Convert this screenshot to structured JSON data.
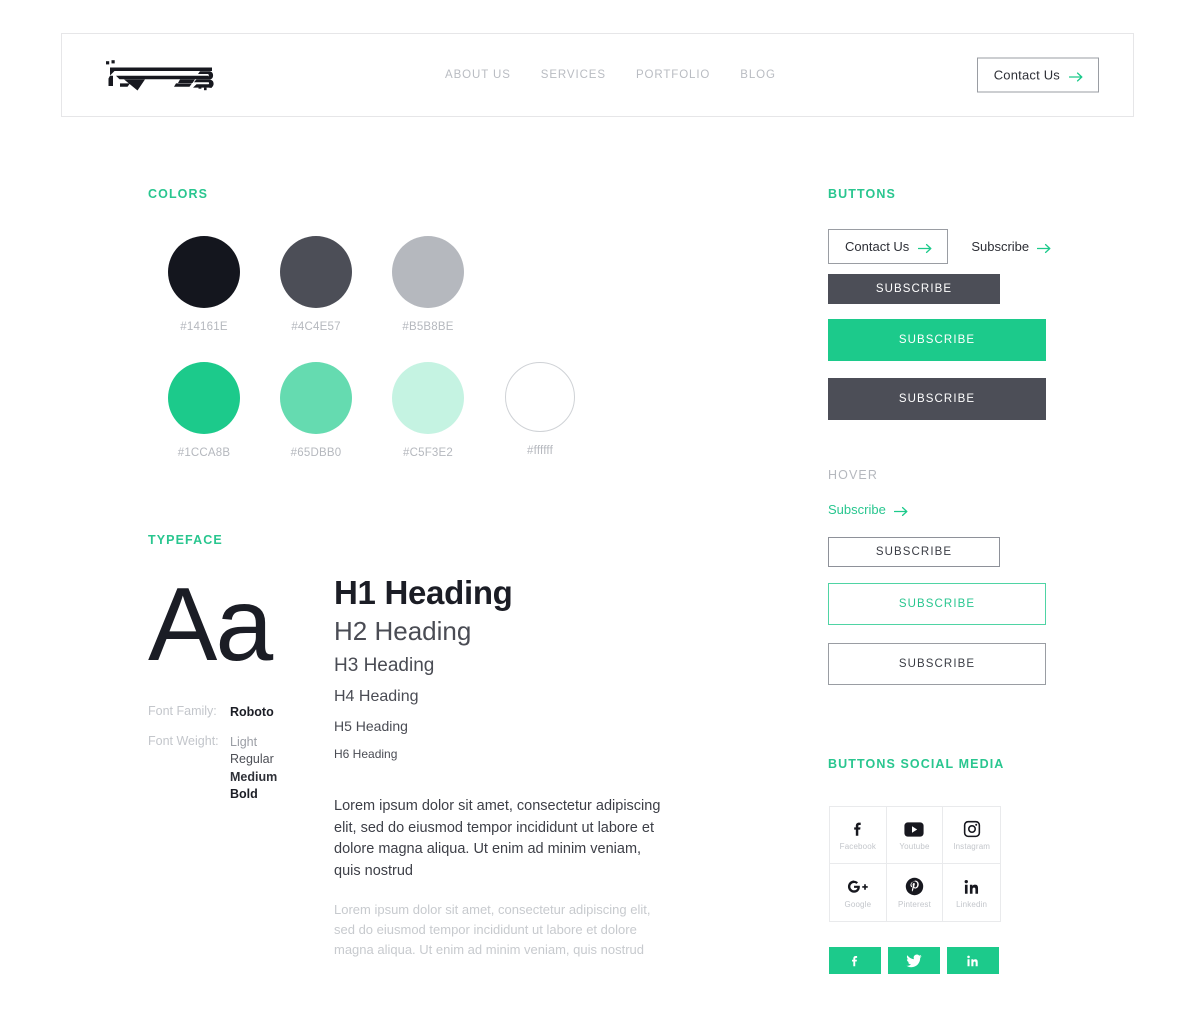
{
  "header": {
    "logo_text": "REVRB",
    "logo_icon": "revrb-logo",
    "nav": [
      {
        "label": "ABOUT US"
      },
      {
        "label": "SERVICES"
      },
      {
        "label": "PORTFOLIO"
      },
      {
        "label": "BLOG"
      }
    ],
    "cta": {
      "label": "Contact Us",
      "icon": "arrow-right-icon"
    }
  },
  "colors": {
    "heading": "COLORS",
    "row1": [
      {
        "hex": "#14161E",
        "label": "#14161E"
      },
      {
        "hex": "#4C4E57",
        "label": "#4C4E57"
      },
      {
        "hex": "#B5B8BE",
        "label": "#B5B8BE"
      }
    ],
    "row2": [
      {
        "hex": "#1CCA8B",
        "label": "#1CCA8B"
      },
      {
        "hex": "#65DBB0",
        "label": "#65DBB0"
      },
      {
        "hex": "#C5F3E2",
        "label": "#C5F3E2"
      },
      {
        "hex": "#ffffff",
        "label": "#ffffff"
      }
    ]
  },
  "typeface": {
    "heading": "TYPEFACE",
    "sample_glyph": "Aa",
    "font_family_label": "Font Family:",
    "font_family_value": "Roboto",
    "font_weight_label": "Font Weight:",
    "font_weights": [
      "Light",
      "Regular",
      "Medium",
      "Bold"
    ],
    "headings": [
      {
        "label": "H1 Heading"
      },
      {
        "label": "H2 Heading"
      },
      {
        "label": "H3 Heading"
      },
      {
        "label": "H4 Heading"
      },
      {
        "label": "H5 Heading"
      },
      {
        "label": "H6 Heading"
      }
    ],
    "paragraph_primary": "Lorem ipsum dolor sit amet, consectetur adipiscing elit, sed do eiusmod tempor incididunt ut labore et dolore magna aliqua. Ut enim ad minim veniam, quis nostrud",
    "paragraph_muted": "Lorem ipsum dolor sit amet, consectetur adipiscing elit, sed do eiusmod tempor incididunt ut labore et dolore magna aliqua. Ut enim ad minim veniam, quis nostrud"
  },
  "buttons": {
    "heading": "BUTTONS",
    "contact_label": "Contact Us",
    "subscribe_link_label": "Subscribe",
    "arrow_icon": "arrow-right-icon",
    "dark_small_label": "SUBSCRIBE",
    "green_large_label": "SUBSCRIBE",
    "dark_large_label": "SUBSCRIBE"
  },
  "hover": {
    "heading": "HOVER",
    "subscribe_link_label": "Subscribe",
    "arrow_icon": "arrow-right-icon",
    "outline_small_label": "SUBSCRIBE",
    "outline_green_label": "SUBSCRIBE",
    "outline_gray_label": "SUBSCRIBE"
  },
  "social": {
    "heading": "BUTTONS SOCIAL MEDIA",
    "grid": [
      {
        "icon": "facebook-icon",
        "label": "Facebook"
      },
      {
        "icon": "youtube-icon",
        "label": "Youtube"
      },
      {
        "icon": "instagram-icon",
        "label": "Instagram"
      },
      {
        "icon": "google-plus-icon",
        "label": "Google"
      },
      {
        "icon": "pinterest-icon",
        "label": "Pinterest"
      },
      {
        "icon": "linkedin-icon",
        "label": "Linkedin"
      }
    ],
    "pills": [
      {
        "icon": "facebook-icon"
      },
      {
        "icon": "twitter-icon"
      },
      {
        "icon": "linkedin-icon"
      }
    ]
  },
  "palette": {
    "accent_green": "#1CCA8B",
    "dark": "#14161E",
    "slate": "#4C4E57",
    "gray": "#B5B8BE"
  }
}
